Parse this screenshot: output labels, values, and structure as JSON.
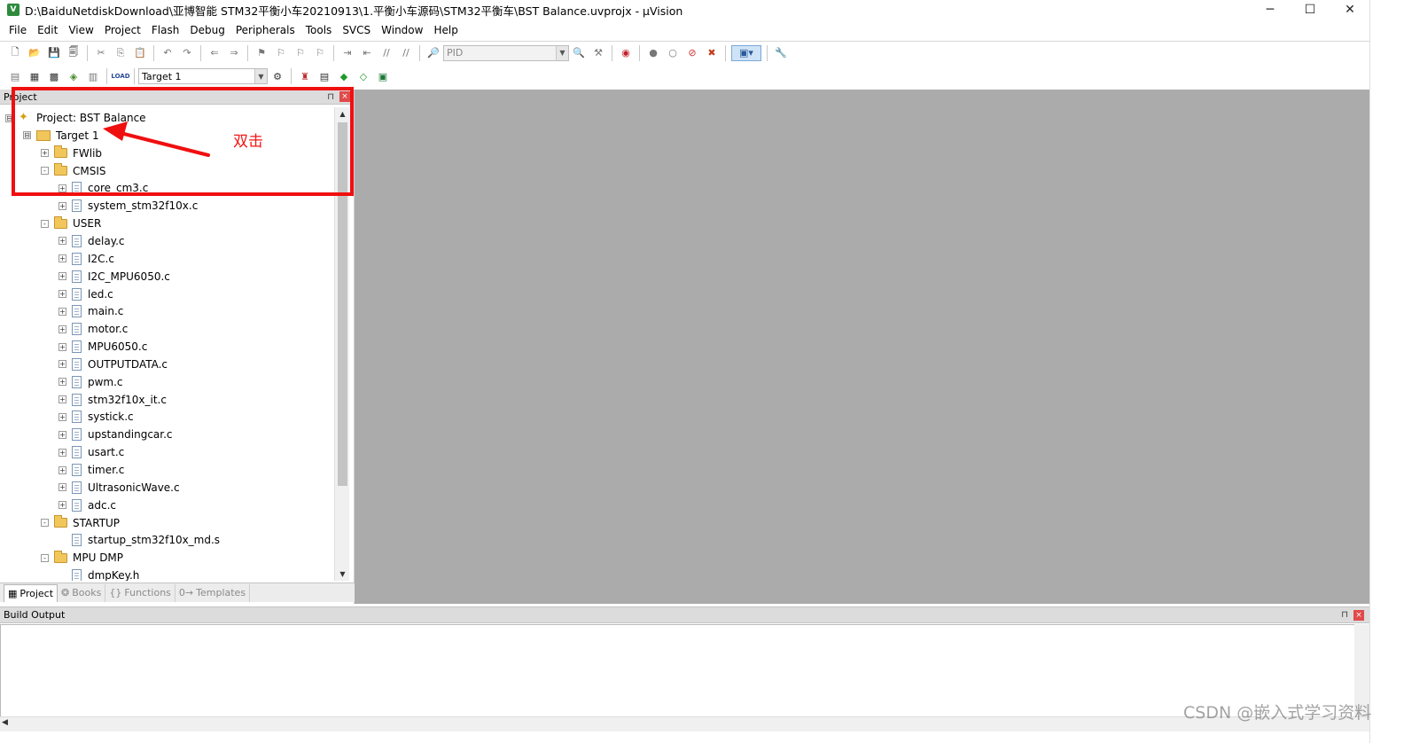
{
  "window": {
    "title": "D:\\BaiduNetdiskDownload\\亚博智能 STM32平衡小车20210913\\1.平衡小车源码\\STM32平衡车\\BST Balance.uvprojx - µVision",
    "minimize": "─",
    "maximize": "☐",
    "close": "✕"
  },
  "menu": [
    "File",
    "Edit",
    "View",
    "Project",
    "Flash",
    "Debug",
    "Peripherals",
    "Tools",
    "SVCS",
    "Window",
    "Help"
  ],
  "toolbar1": {
    "find_combo_value": "PID"
  },
  "toolbar2": {
    "target_combo_value": "Target 1",
    "load_label": "LOAD"
  },
  "project_panel": {
    "title": "Project",
    "pin": "⊓",
    "close": "×",
    "tree": [
      {
        "label": "Project: BST Balance",
        "kind": "project",
        "indent": 0,
        "toggle": "⊟"
      },
      {
        "label": "Target 1",
        "kind": "target",
        "indent": 1,
        "toggle": "⊟"
      },
      {
        "label": "FWlib",
        "kind": "folder",
        "indent": 2,
        "toggle": "+"
      },
      {
        "label": "CMSIS",
        "kind": "folder",
        "indent": 2,
        "toggle": "-"
      },
      {
        "label": "core_cm3.c",
        "kind": "file",
        "indent": 3,
        "toggle": "+"
      },
      {
        "label": "system_stm32f10x.c",
        "kind": "file",
        "indent": 3,
        "toggle": "+"
      },
      {
        "label": "USER",
        "kind": "folder",
        "indent": 2,
        "toggle": "-"
      },
      {
        "label": "delay.c",
        "kind": "file",
        "indent": 3,
        "toggle": "+"
      },
      {
        "label": "I2C.c",
        "kind": "file",
        "indent": 3,
        "toggle": "+"
      },
      {
        "label": "I2C_MPU6050.c",
        "kind": "file",
        "indent": 3,
        "toggle": "+"
      },
      {
        "label": "led.c",
        "kind": "file",
        "indent": 3,
        "toggle": "+"
      },
      {
        "label": "main.c",
        "kind": "file",
        "indent": 3,
        "toggle": "+"
      },
      {
        "label": "motor.c",
        "kind": "file",
        "indent": 3,
        "toggle": "+"
      },
      {
        "label": "MPU6050.c",
        "kind": "file",
        "indent": 3,
        "toggle": "+"
      },
      {
        "label": "OUTPUTDATA.c",
        "kind": "file",
        "indent": 3,
        "toggle": "+"
      },
      {
        "label": "pwm.c",
        "kind": "file",
        "indent": 3,
        "toggle": "+"
      },
      {
        "label": "stm32f10x_it.c",
        "kind": "file",
        "indent": 3,
        "toggle": "+"
      },
      {
        "label": "systick.c",
        "kind": "file",
        "indent": 3,
        "toggle": "+"
      },
      {
        "label": "upstandingcar.c",
        "kind": "file",
        "indent": 3,
        "toggle": "+"
      },
      {
        "label": "usart.c",
        "kind": "file",
        "indent": 3,
        "toggle": "+"
      },
      {
        "label": "timer.c",
        "kind": "file",
        "indent": 3,
        "toggle": "+"
      },
      {
        "label": "UltrasonicWave.c",
        "kind": "file",
        "indent": 3,
        "toggle": "+"
      },
      {
        "label": "adc.c",
        "kind": "file",
        "indent": 3,
        "toggle": "+"
      },
      {
        "label": "STARTUP",
        "kind": "folder",
        "indent": 2,
        "toggle": "-"
      },
      {
        "label": "startup_stm32f10x_md.s",
        "kind": "file",
        "indent": 3,
        "toggle": ""
      },
      {
        "label": "MPU DMP",
        "kind": "folder",
        "indent": 2,
        "toggle": "-"
      },
      {
        "label": "dmpKey.h",
        "kind": "file",
        "indent": 3,
        "toggle": ""
      }
    ],
    "tabs": [
      {
        "label": "Project",
        "icon": "project-tab-icon",
        "glyph": "▦",
        "active": true
      },
      {
        "label": "Books",
        "icon": "books-tab-icon",
        "glyph": "❂",
        "active": false
      },
      {
        "label": "Functions",
        "icon": "functions-tab-icon",
        "glyph": "{}",
        "active": false
      },
      {
        "label": "Templates",
        "icon": "templates-tab-icon",
        "glyph": "0→",
        "active": false
      }
    ]
  },
  "build_output": {
    "title": "Build Output",
    "pin": "⊓",
    "close": "×"
  },
  "annotation": {
    "text": "双击",
    "color": "#f00f0f"
  },
  "watermark": "CSDN @嵌入式学习资料",
  "colors": {
    "editor_background": "#ababab",
    "panel_header": "#dcdcdc",
    "annotation_red": "#f00f0f"
  }
}
